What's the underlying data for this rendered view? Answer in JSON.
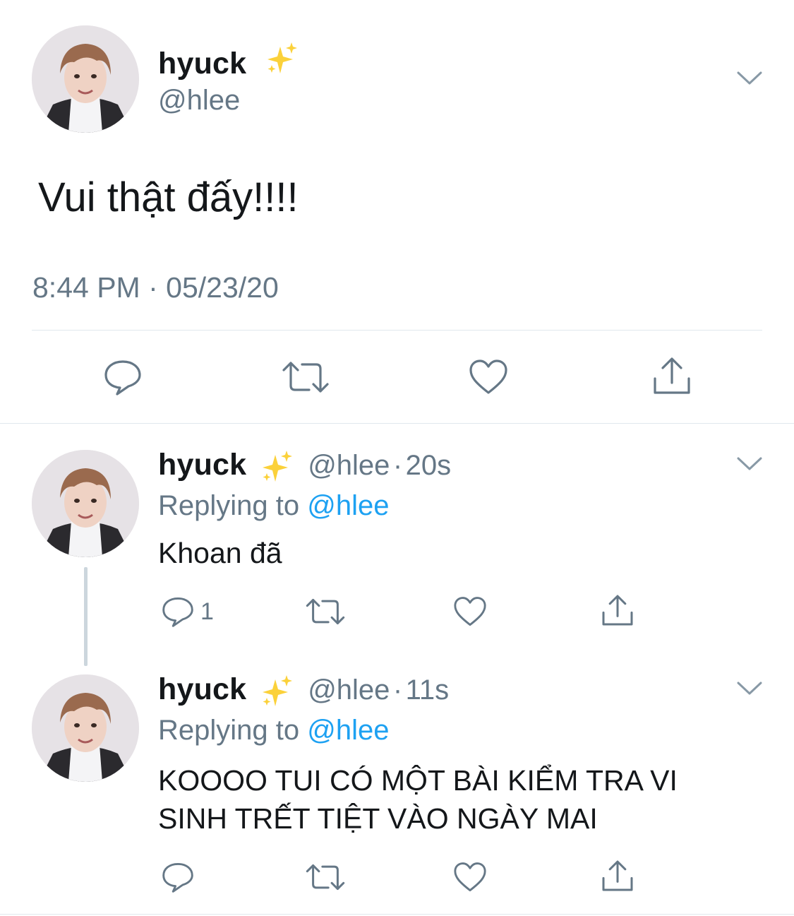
{
  "main_tweet": {
    "name": "hyuck",
    "handle": "@hlee",
    "text": "Vui thật đấy!!!!",
    "time": "8:44 PM",
    "separator": "·",
    "date": "05/23/20"
  },
  "replies": [
    {
      "name": "hyuck",
      "handle": "@hlee",
      "separator": "·",
      "age": "20s",
      "replying_prefix": "Replying to",
      "replying_handle": "@hlee",
      "text": "Khoan đã",
      "reply_count": "1"
    },
    {
      "name": "hyuck",
      "handle": "@hlee",
      "separator": "·",
      "age": "11s",
      "replying_prefix": "Replying to",
      "replying_handle": "@hlee",
      "text_line1": "KOOOO TUI CÓ MỘT BÀI KIỂM TRA VI",
      "text_line2": "SINH TRẾT TIỆT VÀO NGÀY MAI"
    }
  ],
  "icons": [
    "sparkles-emoji",
    "chevron-down-icon",
    "reply-icon",
    "retweet-icon",
    "like-icon",
    "share-icon"
  ],
  "colors": {
    "link": "#1da1f2",
    "muted": "#657786",
    "text": "#14171a",
    "divider": "#e1e8ed",
    "icon": "#657786"
  }
}
